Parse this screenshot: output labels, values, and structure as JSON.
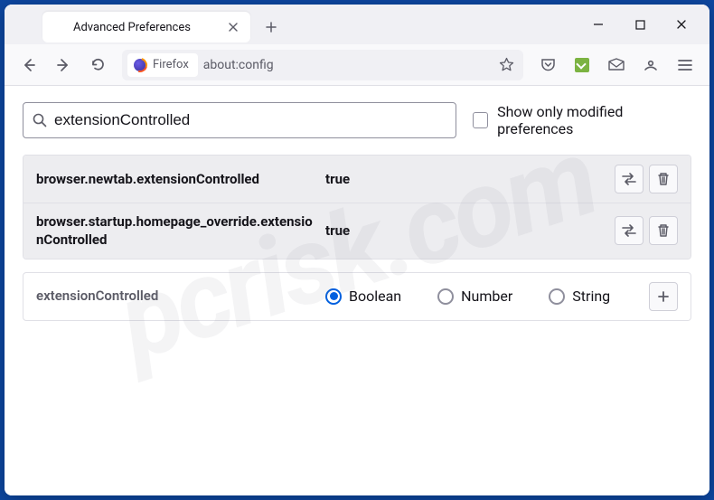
{
  "window": {
    "tab_title": "Advanced Preferences"
  },
  "toolbar": {
    "identity_label": "Firefox",
    "url": "about:config"
  },
  "search": {
    "value": "extensionControlled",
    "checkbox_label": "Show only modified preferences"
  },
  "prefs": [
    {
      "name": "browser.newtab.extensionControlled",
      "value": "true"
    },
    {
      "name": "browser.startup.homepage_override.extensionControlled",
      "value": "true"
    }
  ],
  "new_pref": {
    "name": "extensionControlled",
    "types": {
      "boolean": "Boolean",
      "number": "Number",
      "string": "String"
    }
  },
  "watermark": "pcrisk.com"
}
